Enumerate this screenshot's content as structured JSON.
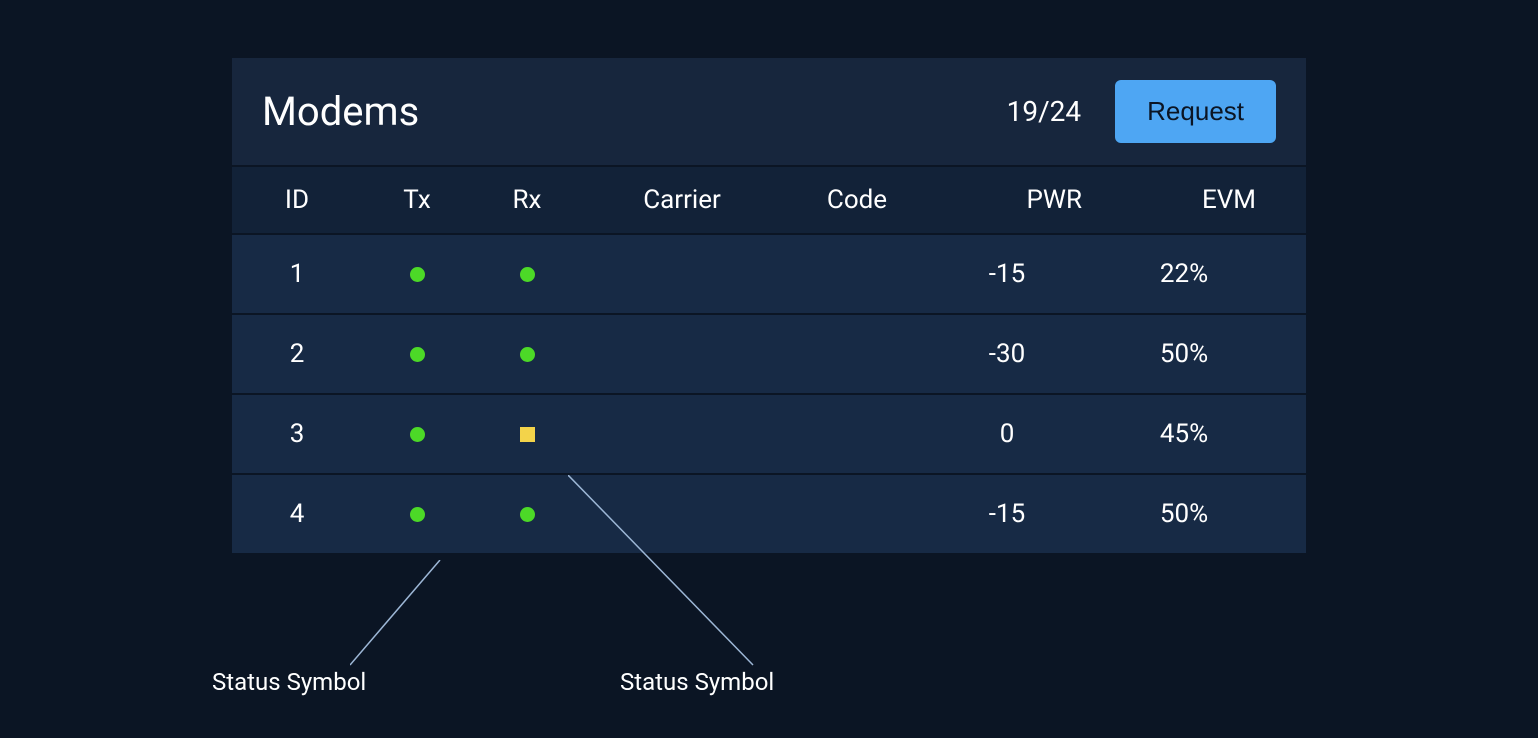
{
  "panel": {
    "title": "Modems",
    "counter": "19/24",
    "request_label": "Request"
  },
  "columns": {
    "id": "ID",
    "tx": "Tx",
    "rx": "Rx",
    "carrier": "Carrier",
    "code": "Code",
    "pwr": "PWR",
    "evm": "EVM"
  },
  "rows": [
    {
      "id": "1",
      "tx_status": "ok",
      "rx_status": "ok",
      "carrier": "",
      "code": "",
      "pwr": "-15",
      "evm": "22%"
    },
    {
      "id": "2",
      "tx_status": "ok",
      "rx_status": "ok",
      "carrier": "",
      "code": "",
      "pwr": "-30",
      "evm": "50%"
    },
    {
      "id": "3",
      "tx_status": "ok",
      "rx_status": "warn",
      "carrier": "",
      "code": "",
      "pwr": "0",
      "evm": "45%"
    },
    {
      "id": "4",
      "tx_status": "ok",
      "rx_status": "ok",
      "carrier": "",
      "code": "",
      "pwr": "-15",
      "evm": "50%"
    }
  ],
  "status_colors": {
    "ok": "#4cd927",
    "warn": "#f3d34a"
  },
  "annotations": {
    "label1": "Status Symbol",
    "label2": "Status Symbol"
  }
}
